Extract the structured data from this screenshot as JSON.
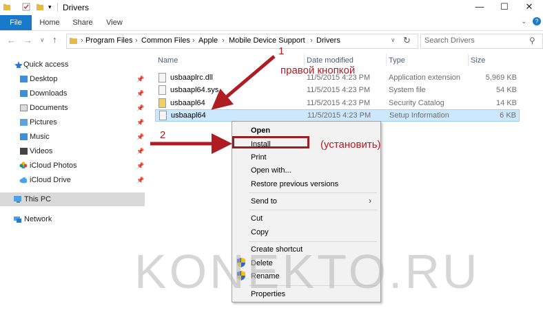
{
  "window": {
    "title": "Drivers",
    "controls": {
      "minimize": "—",
      "maximize": "☐",
      "close": "✕"
    }
  },
  "ribbon": {
    "tabs": [
      "File",
      "Home",
      "Share",
      "View"
    ],
    "help": "?"
  },
  "address": {
    "path": [
      "Program Files",
      "Common Files",
      "Apple",
      "Mobile Device Support",
      "Drivers"
    ],
    "search_placeholder": "Search Drivers"
  },
  "nav": {
    "items": [
      {
        "label": "Quick access",
        "pinned": false
      },
      {
        "label": "Desktop",
        "pinned": true
      },
      {
        "label": "Downloads",
        "pinned": true
      },
      {
        "label": "Documents",
        "pinned": true
      },
      {
        "label": "Pictures",
        "pinned": true
      },
      {
        "label": "Music",
        "pinned": true
      },
      {
        "label": "Videos",
        "pinned": true
      },
      {
        "label": "iCloud Photos",
        "pinned": true
      },
      {
        "label": "iCloud Drive",
        "pinned": true
      },
      {
        "label": "This PC",
        "pinned": false
      },
      {
        "label": "Network",
        "pinned": false
      }
    ]
  },
  "columns": {
    "name": "Name",
    "date": "Date modified",
    "type": "Type",
    "size": "Size"
  },
  "files": [
    {
      "name": "usbaaplrc.dll",
      "date": "11/5/2015 4:23 PM",
      "type": "Application extension",
      "size": "5,969 KB"
    },
    {
      "name": "usbaapl64.sys",
      "date": "11/5/2015 4:23 PM",
      "type": "System file",
      "size": "54 KB"
    },
    {
      "name": "usbaapl64",
      "date": "11/5/2015 4:23 PM",
      "type": "Security Catalog",
      "size": "14 KB"
    },
    {
      "name": "usbaapl64",
      "date": "11/5/2015 4:23 PM",
      "type": "Setup Information",
      "size": "6 KB"
    }
  ],
  "context_menu": {
    "open": "Open",
    "install": "Install",
    "print": "Print",
    "open_with": "Open with...",
    "restore": "Restore previous versions",
    "send_to": "Send to",
    "cut": "Cut",
    "copy": "Copy",
    "create_shortcut": "Create shortcut",
    "delete": "Delete",
    "rename": "Rename",
    "properties": "Properties"
  },
  "annotations": {
    "step1_number": "1",
    "step1_text": "правой кнопкой",
    "step2_number": "2",
    "step2_text": "(установить)"
  },
  "watermark": "KONEKTO.RU",
  "colors": {
    "accent": "#1979ca",
    "selection": "#cce8ff",
    "annotation": "#b01c23"
  }
}
